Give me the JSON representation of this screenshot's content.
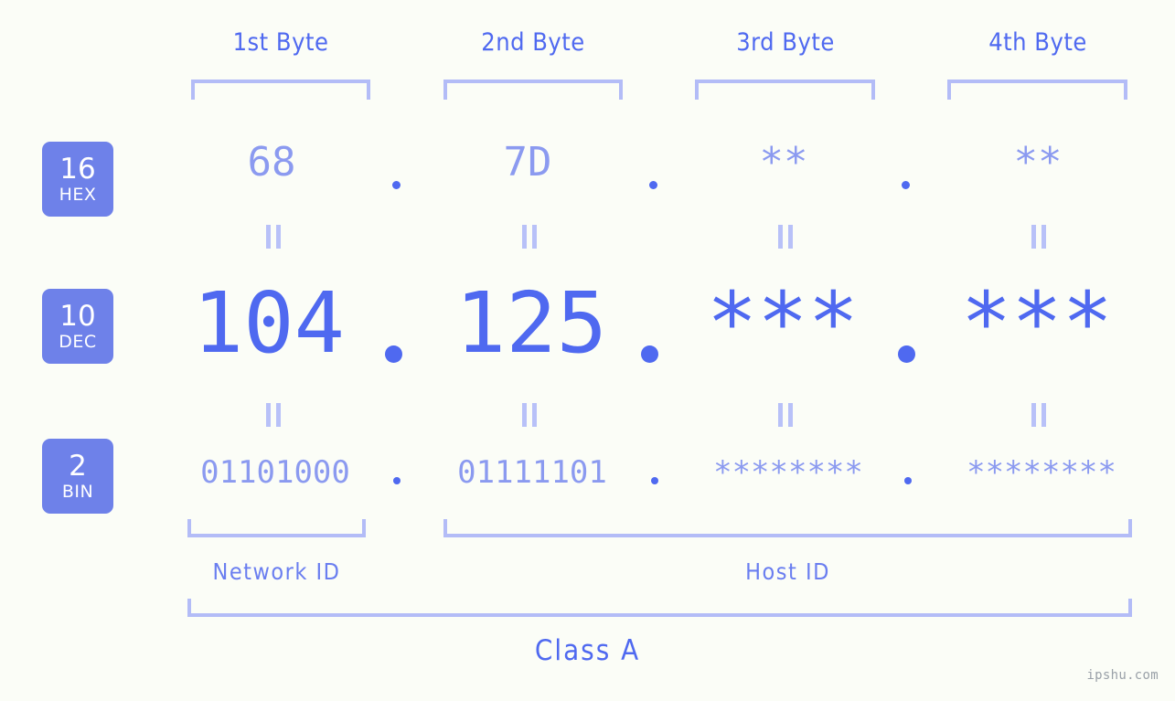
{
  "background_color": "#fbfdf7",
  "accent_color": "#4f69f0",
  "accent_light_color": "#8b9af0",
  "bracket_color": "#b3bcf7",
  "badge_color": "#6e81e9",
  "headers": [
    {
      "label": "1st Byte"
    },
    {
      "label": "2nd Byte"
    },
    {
      "label": "3rd Byte"
    },
    {
      "label": "4th Byte"
    }
  ],
  "rows": [
    {
      "radix": "16",
      "radix_label": "HEX",
      "values": [
        "68",
        "7D",
        "**",
        "**"
      ],
      "separator": "."
    },
    {
      "radix": "10",
      "radix_label": "DEC",
      "values": [
        "104",
        "125",
        "***",
        "***"
      ],
      "separator": "."
    },
    {
      "radix": "2",
      "radix_label": "BIN",
      "values": [
        "01101000",
        "01111101",
        "********",
        "********"
      ],
      "separator": "."
    }
  ],
  "equals_symbol": "=",
  "id_sections": [
    {
      "label": "Network ID"
    },
    {
      "label": "Host ID"
    }
  ],
  "class_label": "Class A",
  "watermark": "ipshu.com"
}
